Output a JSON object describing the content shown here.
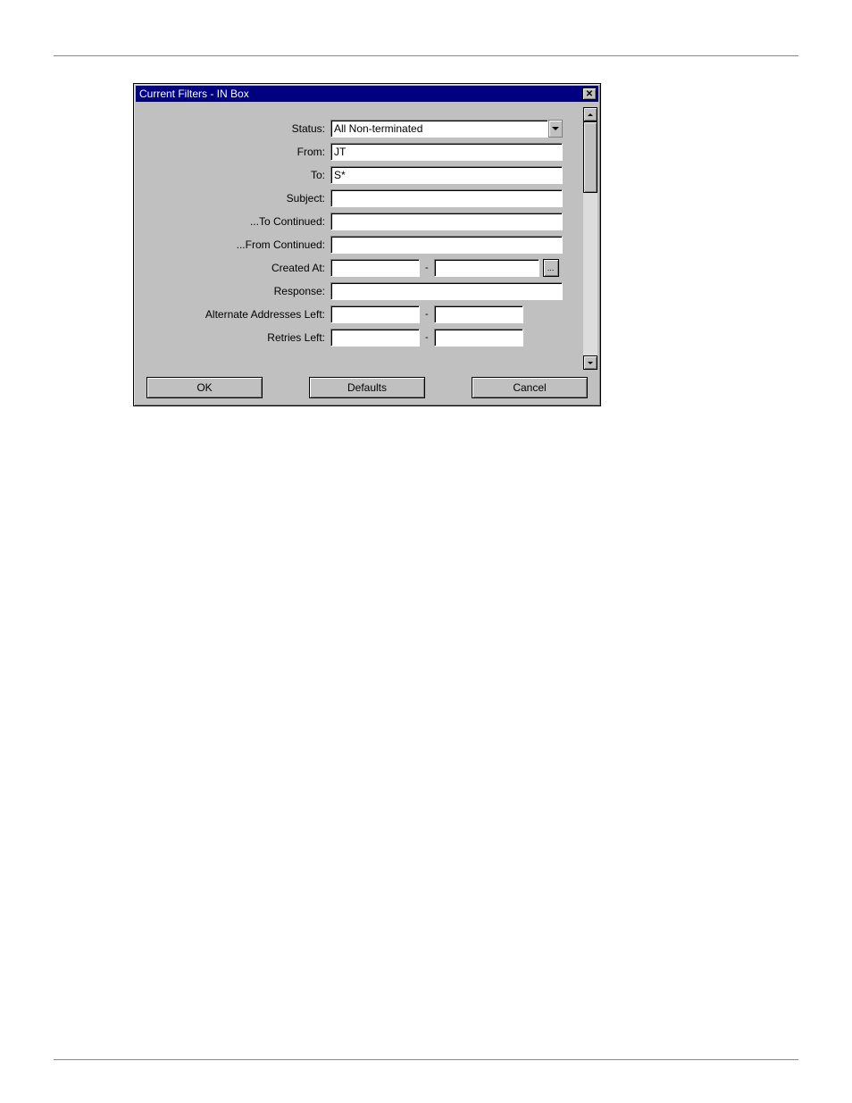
{
  "dialog": {
    "title": "Current Filters - IN Box",
    "fields": {
      "status": {
        "label": "Status:",
        "value": "All Non-terminated"
      },
      "from": {
        "label": "From:",
        "value": "JT"
      },
      "to": {
        "label": "To:",
        "value": "S*"
      },
      "subject": {
        "label": "Subject:",
        "value": ""
      },
      "to_continued": {
        "label": "...To Continued:",
        "value": ""
      },
      "from_continued": {
        "label": "...From Continued:",
        "value": ""
      },
      "created_at": {
        "label": "Created At:",
        "from": "",
        "to": ""
      },
      "response": {
        "label": "Response:",
        "value": ""
      },
      "alt_addresses_left": {
        "label": "Alternate Addresses Left:",
        "from": "",
        "to": ""
      },
      "retries_left": {
        "label": "Retries Left:",
        "from": "",
        "to": ""
      }
    },
    "range_separator": "-",
    "ellipsis": "...",
    "buttons": {
      "ok": "OK",
      "defaults": "Defaults",
      "cancel": "Cancel"
    }
  }
}
